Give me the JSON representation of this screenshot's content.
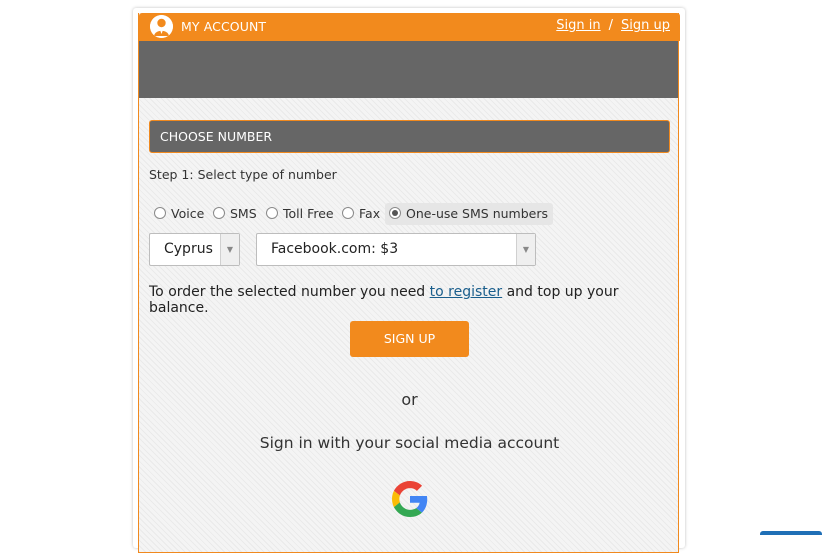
{
  "header": {
    "title": "MY ACCOUNT",
    "sign_in": "Sign in",
    "separator": "/",
    "sign_up": "Sign up",
    "icon": "account-icon"
  },
  "section": {
    "title": "CHOOSE NUMBER",
    "step_label": "Step 1: Select type of number"
  },
  "number_types": [
    {
      "label": "Voice",
      "selected": false
    },
    {
      "label": "SMS",
      "selected": false
    },
    {
      "label": "Toll Free",
      "selected": false
    },
    {
      "label": "Fax",
      "selected": false
    },
    {
      "label": "One-use SMS numbers",
      "selected": true
    }
  ],
  "country_select": {
    "value": "Cyprus"
  },
  "service_select": {
    "value": "Facebook.com: $3"
  },
  "order_text": {
    "before": "To order the selected number you need ",
    "link": "to register",
    "after": " and top up your balance."
  },
  "signup_button": "SIGN UP",
  "or_text": "or",
  "social": {
    "title": "Sign in with your social media account",
    "icon": "google-icon"
  },
  "colors": {
    "accent": "#f28a1d",
    "header_gray": "#666666",
    "link": "#1a5e8c"
  }
}
